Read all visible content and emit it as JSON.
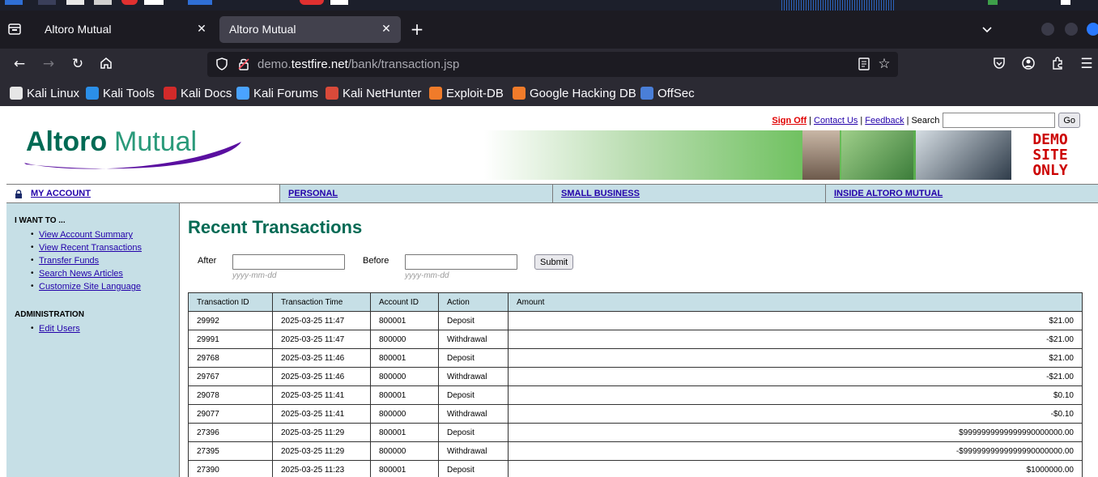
{
  "browser": {
    "tabs": [
      {
        "title": "Altoro Mutual"
      },
      {
        "title": "Altoro Mutual"
      }
    ],
    "url": {
      "prefix": "demo.",
      "host": "testfire.net",
      "path": "/bank/transaction.jsp"
    },
    "bookmarks": [
      {
        "label": "Kali Linux",
        "color": "#e6e6e6"
      },
      {
        "label": "Kali Tools",
        "color": "#2b8fe8"
      },
      {
        "label": "Kali Docs",
        "color": "#d22a2a"
      },
      {
        "label": "Kali Forums",
        "color": "#4aa3ff"
      },
      {
        "label": "Kali NetHunter",
        "color": "#d94a3a"
      },
      {
        "label": "Exploit-DB",
        "color": "#f07b2a"
      },
      {
        "label": "Google Hacking DB",
        "color": "#f07b2a"
      },
      {
        "label": "OffSec",
        "color": "#4a7fd8"
      }
    ]
  },
  "site": {
    "logo": {
      "part1": "Altoro",
      "part2": "Mutual"
    },
    "top_links": {
      "sign_off": "Sign Off",
      "contact": "Contact Us",
      "feedback": "Feedback",
      "search_label": "Search",
      "go": "Go"
    },
    "demo_banner": [
      "DEMO",
      "SITE",
      "ONLY"
    ],
    "menu": [
      "MY ACCOUNT",
      "PERSONAL",
      "SMALL BUSINESS",
      "INSIDE ALTORO MUTUAL"
    ],
    "sidebar": {
      "heading1": "I WANT TO ...",
      "links1": [
        "View Account Summary",
        "View Recent Transactions",
        "Transfer Funds",
        "Search News Articles",
        "Customize Site Language"
      ],
      "heading2": "ADMINISTRATION",
      "links2": [
        "Edit Users"
      ]
    },
    "main": {
      "title": "Recent Transactions",
      "after_label": "After",
      "before_label": "Before",
      "after_hint": "yyyy-mm-dd",
      "before_hint": "yyyy-mm-dd",
      "submit": "Submit"
    },
    "table": {
      "headers": [
        "Transaction ID",
        "Transaction Time",
        "Account ID",
        "Action",
        "Amount"
      ],
      "rows": [
        [
          "29992",
          "2025-03-25 11:47",
          "800001",
          "Deposit",
          "$21.00"
        ],
        [
          "29991",
          "2025-03-25 11:47",
          "800000",
          "Withdrawal",
          "-$21.00"
        ],
        [
          "29768",
          "2025-03-25 11:46",
          "800001",
          "Deposit",
          "$21.00"
        ],
        [
          "29767",
          "2025-03-25 11:46",
          "800000",
          "Withdrawal",
          "-$21.00"
        ],
        [
          "29078",
          "2025-03-25 11:41",
          "800001",
          "Deposit",
          "$0.10"
        ],
        [
          "29077",
          "2025-03-25 11:41",
          "800000",
          "Withdrawal",
          "-$0.10"
        ],
        [
          "27396",
          "2025-03-25 11:29",
          "800001",
          "Deposit",
          "$9999999999999990000000.00"
        ],
        [
          "27395",
          "2025-03-25 11:29",
          "800000",
          "Withdrawal",
          "-$9999999999999990000000.00"
        ],
        [
          "27390",
          "2025-03-25 11:23",
          "800001",
          "Deposit",
          "$1000000.00"
        ]
      ]
    }
  }
}
